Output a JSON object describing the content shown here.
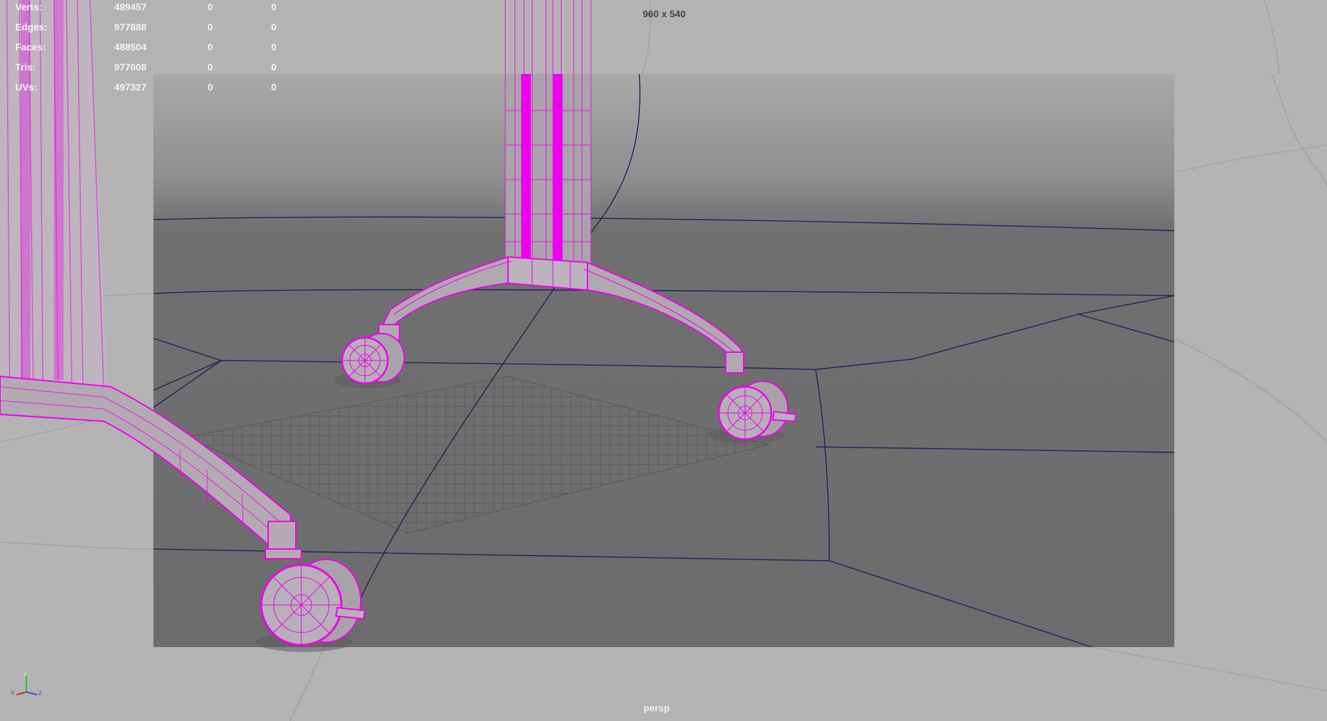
{
  "hud": {
    "stats": [
      {
        "label": "Verts:",
        "value": "489457",
        "selected": "0",
        "tri_sel": "0"
      },
      {
        "label": "Edges:",
        "value": "977888",
        "selected": "0",
        "tri_sel": "0"
      },
      {
        "label": "Faces:",
        "value": "488504",
        "selected": "0",
        "tri_sel": "0"
      },
      {
        "label": "Tris:",
        "value": "977008",
        "selected": "0",
        "tri_sel": "0"
      },
      {
        "label": "UVs:",
        "value": "497327",
        "selected": "0",
        "tri_sel": "0"
      }
    ],
    "resolution": "960 x 540",
    "camera": "persp"
  },
  "axis_gizmo": {
    "x": "x",
    "y": "y",
    "z": "z"
  },
  "colors": {
    "viewport_bg": "#b3b3b3",
    "resolution_gate": "#6f6f6f",
    "wireframe_selected": "#ee00ee",
    "ground_lines": "#20205a",
    "grid": "#4a4a4a"
  }
}
